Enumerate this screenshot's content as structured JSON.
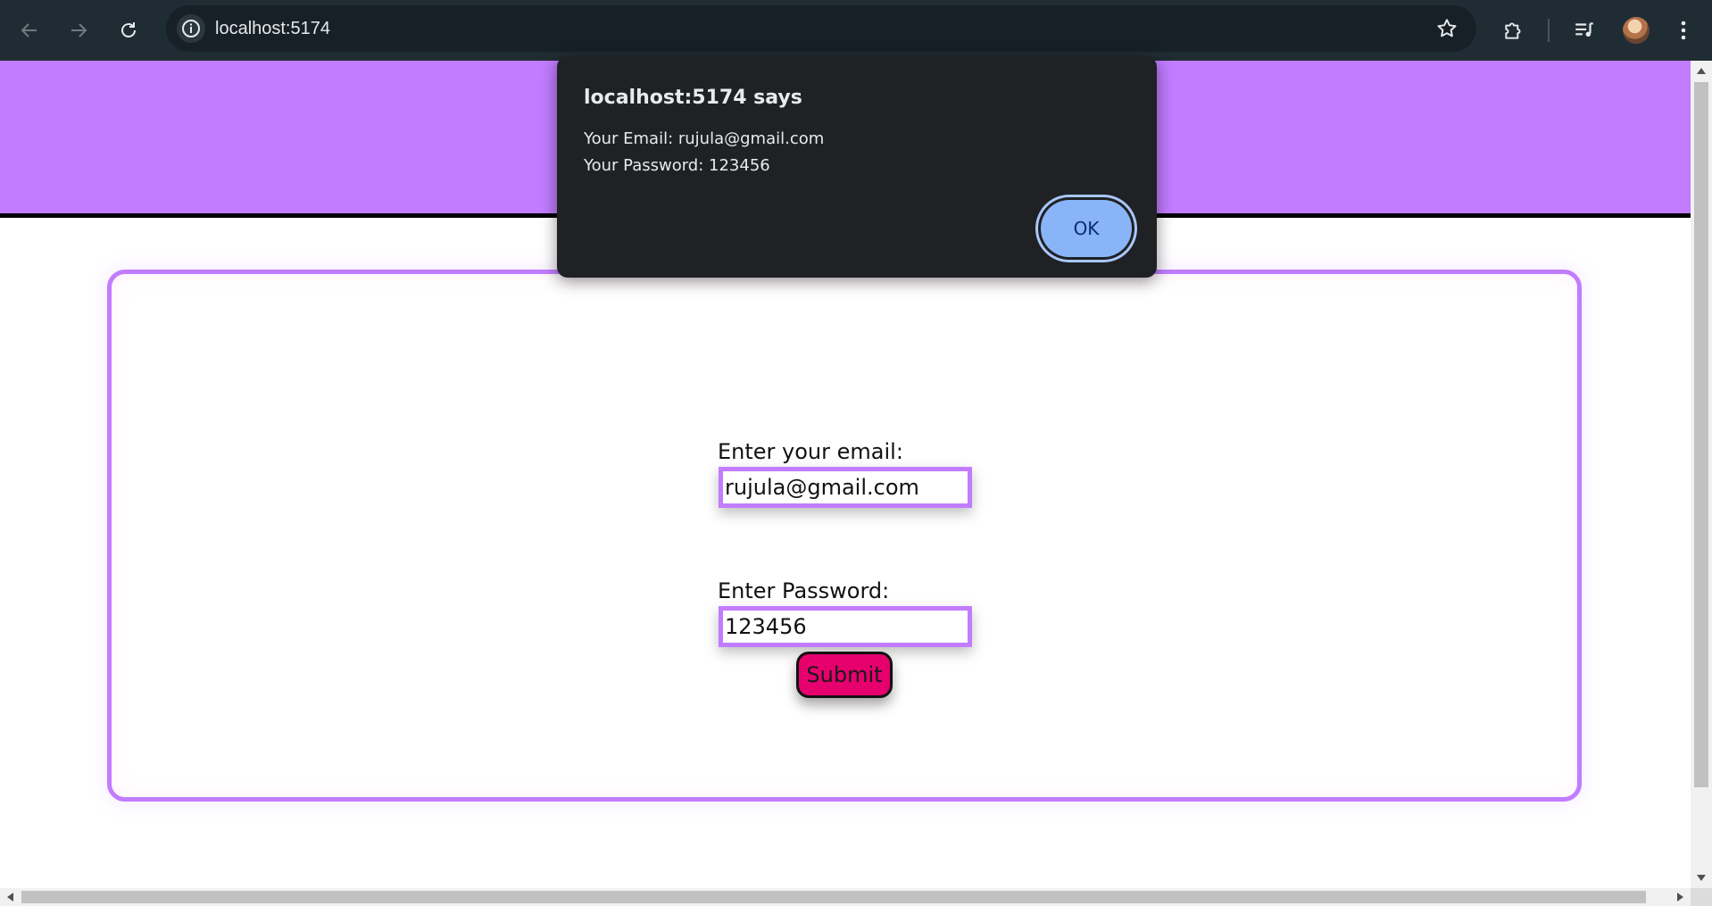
{
  "browser": {
    "url": "localhost:5174",
    "back_icon": "arrow-left-icon",
    "forward_icon": "arrow-right-icon",
    "reload_icon": "reload-icon",
    "site_info_icon": "info-icon",
    "bookmark_icon": "star-icon",
    "extensions_icon": "puzzle-icon",
    "media_icon": "playlist-icon",
    "menu_icon": "kebab-menu-icon"
  },
  "colors": {
    "header_band": "#c17cff",
    "card_border": "#c17cff",
    "submit_bg": "#e6006e",
    "alert_bg": "#1f2124",
    "alert_ok_bg": "#8ab4f8"
  },
  "form": {
    "email_label": "Enter your email:",
    "email_value": "rujula@gmail.com",
    "password_label": "Enter Password:",
    "password_value": "123456",
    "submit_label": "Submit"
  },
  "alert": {
    "title": "localhost:5174 says",
    "line1": "Your Email: rujula@gmail.com",
    "line2": "Your Password: 123456",
    "ok_label": "OK"
  }
}
